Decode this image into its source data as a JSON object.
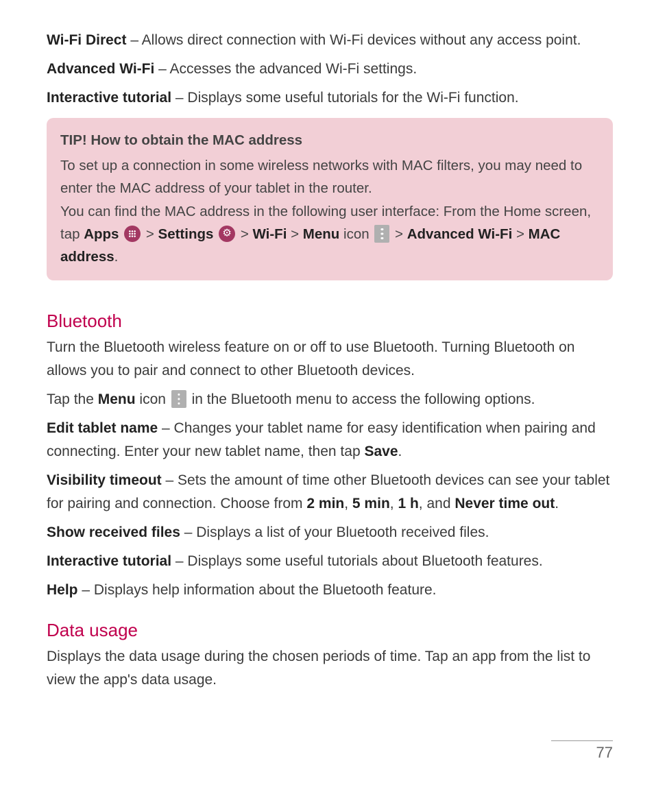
{
  "wifi": {
    "direct": {
      "label": "Wi-Fi Direct",
      "desc": " – Allows direct connection with Wi-Fi devices without any access point."
    },
    "advanced": {
      "label": "Advanced Wi-Fi",
      "desc": " – Accesses the advanced Wi-Fi settings."
    },
    "tutorial": {
      "label": "Interactive tutorial",
      "desc": " – Displays some useful tutorials for the Wi-Fi function."
    }
  },
  "tip": {
    "title": "TIP! How to obtain the MAC address",
    "line1": "To set up a connection in some wireless networks with MAC filters, you may need to enter the MAC address of your tablet in the router.",
    "line2a": "You can find the MAC address in the following user interface: From the Home screen, tap ",
    "apps": "Apps",
    "sep": " > ",
    "settings": "Settings",
    "wifi": "Wi-Fi",
    "menu": "Menu",
    "icon_word": " icon ",
    "adv_wifi": "Advanced Wi-Fi",
    "mac": "MAC address",
    "period": "."
  },
  "bluetooth": {
    "heading": "Bluetooth",
    "intro": "Turn the Bluetooth wireless feature on or off to use Bluetooth. Turning Bluetooth on allows you to pair and connect to other Bluetooth devices.",
    "tap_a": "Tap the ",
    "menu": "Menu",
    "icon_word": " icon ",
    "tap_b": " in the Bluetooth menu to access the following options.",
    "edit": {
      "label": "Edit tablet name",
      "desc_a": " – Changes your tablet name for easy identification when pairing and connecting. Enter your new tablet name, then tap ",
      "save": "Save",
      "desc_b": "."
    },
    "visibility": {
      "label": "Visibility timeout",
      "desc_a": " – Sets the amount of time other Bluetooth devices can see your tablet for pairing and connection. Choose from ",
      "v1": "2 min",
      "c1": ", ",
      "v2": "5 min",
      "c2": ", ",
      "v3": "1 h",
      "c3": ", and ",
      "v4": "Never time out",
      "desc_b": "."
    },
    "show_files": {
      "label": "Show received files",
      "desc": " – Displays a list of your Bluetooth received files."
    },
    "tutorial": {
      "label": "Interactive tutorial",
      "desc": " – Displays some useful tutorials about Bluetooth features."
    },
    "help": {
      "label": "Help",
      "desc": " – Displays help information about the Bluetooth feature."
    }
  },
  "data_usage": {
    "heading": "Data usage",
    "desc": "Displays the data usage during the chosen periods of time. Tap an app from the list to view the app's data usage."
  },
  "page_number": "77"
}
